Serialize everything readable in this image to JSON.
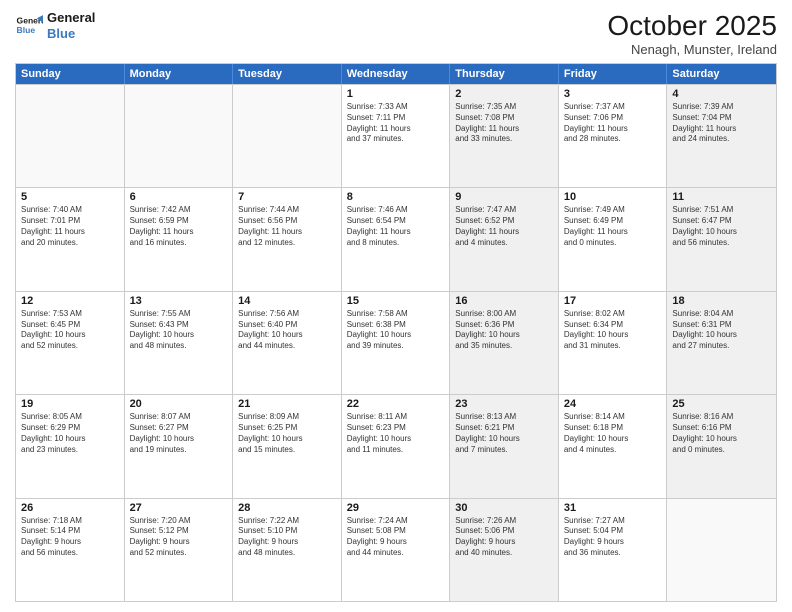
{
  "header": {
    "logo_line1": "General",
    "logo_line2": "Blue",
    "month": "October 2025",
    "location": "Nenagh, Munster, Ireland"
  },
  "days_of_week": [
    "Sunday",
    "Monday",
    "Tuesday",
    "Wednesday",
    "Thursday",
    "Friday",
    "Saturday"
  ],
  "rows": [
    [
      {
        "day": "",
        "text": "",
        "shaded": false,
        "empty": true
      },
      {
        "day": "",
        "text": "",
        "shaded": false,
        "empty": true
      },
      {
        "day": "",
        "text": "",
        "shaded": false,
        "empty": true
      },
      {
        "day": "1",
        "text": "Sunrise: 7:33 AM\nSunset: 7:11 PM\nDaylight: 11 hours\nand 37 minutes.",
        "shaded": false,
        "empty": false
      },
      {
        "day": "2",
        "text": "Sunrise: 7:35 AM\nSunset: 7:08 PM\nDaylight: 11 hours\nand 33 minutes.",
        "shaded": true,
        "empty": false
      },
      {
        "day": "3",
        "text": "Sunrise: 7:37 AM\nSunset: 7:06 PM\nDaylight: 11 hours\nand 28 minutes.",
        "shaded": false,
        "empty": false
      },
      {
        "day": "4",
        "text": "Sunrise: 7:39 AM\nSunset: 7:04 PM\nDaylight: 11 hours\nand 24 minutes.",
        "shaded": true,
        "empty": false
      }
    ],
    [
      {
        "day": "5",
        "text": "Sunrise: 7:40 AM\nSunset: 7:01 PM\nDaylight: 11 hours\nand 20 minutes.",
        "shaded": false,
        "empty": false
      },
      {
        "day": "6",
        "text": "Sunrise: 7:42 AM\nSunset: 6:59 PM\nDaylight: 11 hours\nand 16 minutes.",
        "shaded": false,
        "empty": false
      },
      {
        "day": "7",
        "text": "Sunrise: 7:44 AM\nSunset: 6:56 PM\nDaylight: 11 hours\nand 12 minutes.",
        "shaded": false,
        "empty": false
      },
      {
        "day": "8",
        "text": "Sunrise: 7:46 AM\nSunset: 6:54 PM\nDaylight: 11 hours\nand 8 minutes.",
        "shaded": false,
        "empty": false
      },
      {
        "day": "9",
        "text": "Sunrise: 7:47 AM\nSunset: 6:52 PM\nDaylight: 11 hours\nand 4 minutes.",
        "shaded": true,
        "empty": false
      },
      {
        "day": "10",
        "text": "Sunrise: 7:49 AM\nSunset: 6:49 PM\nDaylight: 11 hours\nand 0 minutes.",
        "shaded": false,
        "empty": false
      },
      {
        "day": "11",
        "text": "Sunrise: 7:51 AM\nSunset: 6:47 PM\nDaylight: 10 hours\nand 56 minutes.",
        "shaded": true,
        "empty": false
      }
    ],
    [
      {
        "day": "12",
        "text": "Sunrise: 7:53 AM\nSunset: 6:45 PM\nDaylight: 10 hours\nand 52 minutes.",
        "shaded": false,
        "empty": false
      },
      {
        "day": "13",
        "text": "Sunrise: 7:55 AM\nSunset: 6:43 PM\nDaylight: 10 hours\nand 48 minutes.",
        "shaded": false,
        "empty": false
      },
      {
        "day": "14",
        "text": "Sunrise: 7:56 AM\nSunset: 6:40 PM\nDaylight: 10 hours\nand 44 minutes.",
        "shaded": false,
        "empty": false
      },
      {
        "day": "15",
        "text": "Sunrise: 7:58 AM\nSunset: 6:38 PM\nDaylight: 10 hours\nand 39 minutes.",
        "shaded": false,
        "empty": false
      },
      {
        "day": "16",
        "text": "Sunrise: 8:00 AM\nSunset: 6:36 PM\nDaylight: 10 hours\nand 35 minutes.",
        "shaded": true,
        "empty": false
      },
      {
        "day": "17",
        "text": "Sunrise: 8:02 AM\nSunset: 6:34 PM\nDaylight: 10 hours\nand 31 minutes.",
        "shaded": false,
        "empty": false
      },
      {
        "day": "18",
        "text": "Sunrise: 8:04 AM\nSunset: 6:31 PM\nDaylight: 10 hours\nand 27 minutes.",
        "shaded": true,
        "empty": false
      }
    ],
    [
      {
        "day": "19",
        "text": "Sunrise: 8:05 AM\nSunset: 6:29 PM\nDaylight: 10 hours\nand 23 minutes.",
        "shaded": false,
        "empty": false
      },
      {
        "day": "20",
        "text": "Sunrise: 8:07 AM\nSunset: 6:27 PM\nDaylight: 10 hours\nand 19 minutes.",
        "shaded": false,
        "empty": false
      },
      {
        "day": "21",
        "text": "Sunrise: 8:09 AM\nSunset: 6:25 PM\nDaylight: 10 hours\nand 15 minutes.",
        "shaded": false,
        "empty": false
      },
      {
        "day": "22",
        "text": "Sunrise: 8:11 AM\nSunset: 6:23 PM\nDaylight: 10 hours\nand 11 minutes.",
        "shaded": false,
        "empty": false
      },
      {
        "day": "23",
        "text": "Sunrise: 8:13 AM\nSunset: 6:21 PM\nDaylight: 10 hours\nand 7 minutes.",
        "shaded": true,
        "empty": false
      },
      {
        "day": "24",
        "text": "Sunrise: 8:14 AM\nSunset: 6:18 PM\nDaylight: 10 hours\nand 4 minutes.",
        "shaded": false,
        "empty": false
      },
      {
        "day": "25",
        "text": "Sunrise: 8:16 AM\nSunset: 6:16 PM\nDaylight: 10 hours\nand 0 minutes.",
        "shaded": true,
        "empty": false
      }
    ],
    [
      {
        "day": "26",
        "text": "Sunrise: 7:18 AM\nSunset: 5:14 PM\nDaylight: 9 hours\nand 56 minutes.",
        "shaded": false,
        "empty": false
      },
      {
        "day": "27",
        "text": "Sunrise: 7:20 AM\nSunset: 5:12 PM\nDaylight: 9 hours\nand 52 minutes.",
        "shaded": false,
        "empty": false
      },
      {
        "day": "28",
        "text": "Sunrise: 7:22 AM\nSunset: 5:10 PM\nDaylight: 9 hours\nand 48 minutes.",
        "shaded": false,
        "empty": false
      },
      {
        "day": "29",
        "text": "Sunrise: 7:24 AM\nSunset: 5:08 PM\nDaylight: 9 hours\nand 44 minutes.",
        "shaded": false,
        "empty": false
      },
      {
        "day": "30",
        "text": "Sunrise: 7:26 AM\nSunset: 5:06 PM\nDaylight: 9 hours\nand 40 minutes.",
        "shaded": true,
        "empty": false
      },
      {
        "day": "31",
        "text": "Sunrise: 7:27 AM\nSunset: 5:04 PM\nDaylight: 9 hours\nand 36 minutes.",
        "shaded": false,
        "empty": false
      },
      {
        "day": "",
        "text": "",
        "shaded": true,
        "empty": true
      }
    ]
  ]
}
